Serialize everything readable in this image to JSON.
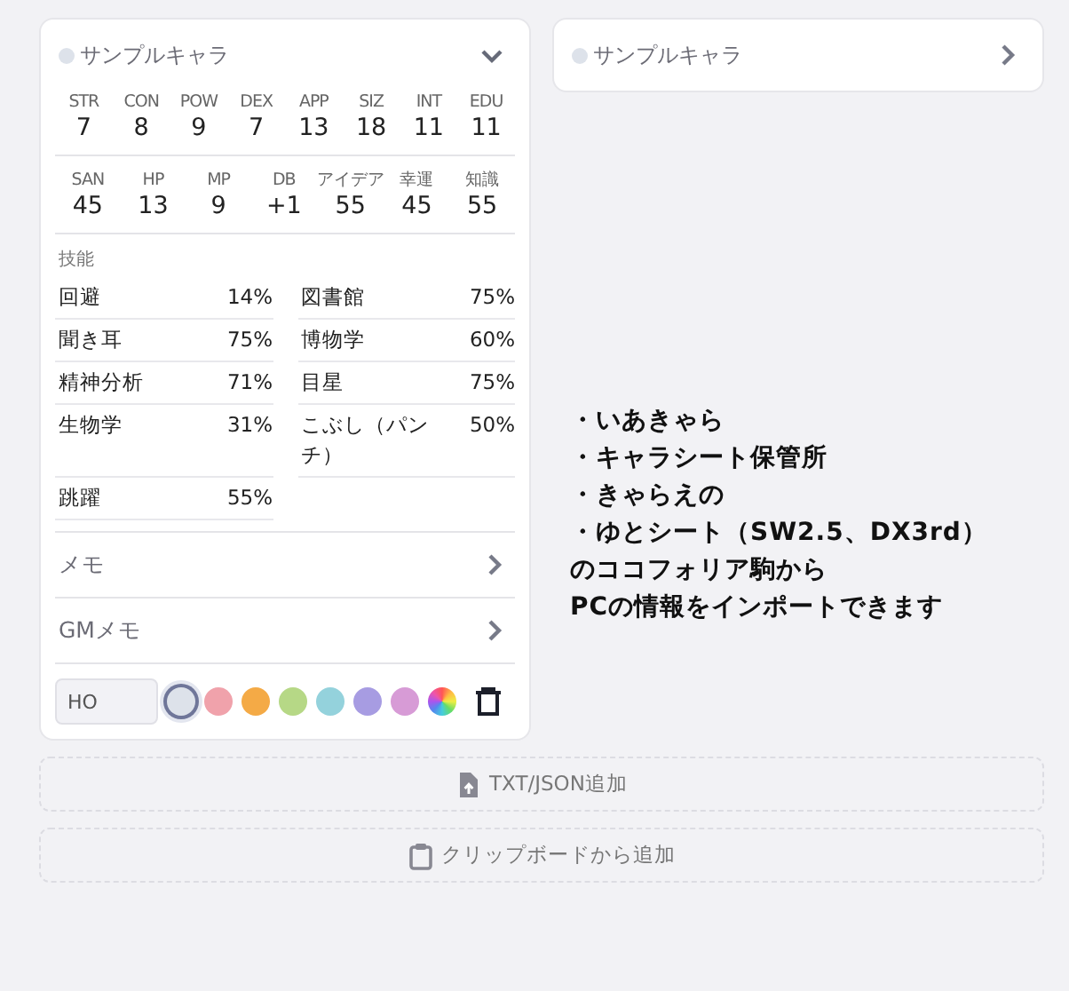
{
  "characters": [
    {
      "name": "サンプルキャラ",
      "expanded": true,
      "color": "#dde2ea",
      "stats": [
        [
          {
            "label": "STR",
            "value": "7"
          },
          {
            "label": "CON",
            "value": "8"
          },
          {
            "label": "POW",
            "value": "9"
          },
          {
            "label": "DEX",
            "value": "7"
          },
          {
            "label": "APP",
            "value": "13"
          },
          {
            "label": "SIZ",
            "value": "18"
          },
          {
            "label": "INT",
            "value": "11"
          },
          {
            "label": "EDU",
            "value": "11"
          }
        ],
        [
          {
            "label": "SAN",
            "value": "45"
          },
          {
            "label": "HP",
            "value": "13"
          },
          {
            "label": "MP",
            "value": "9"
          },
          {
            "label": "DB",
            "value": "+1"
          },
          {
            "label": "アイデア",
            "value": "55"
          },
          {
            "label": "幸運",
            "value": "45"
          },
          {
            "label": "知識",
            "value": "55"
          }
        ]
      ],
      "skills_label": "技能",
      "skills": [
        {
          "name": "回避",
          "value": "14%"
        },
        {
          "name": "図書館",
          "value": "75%"
        },
        {
          "name": "聞き耳",
          "value": "75%"
        },
        {
          "name": "博物学",
          "value": "60%"
        },
        {
          "name": "精神分析",
          "value": "71%"
        },
        {
          "name": "目星",
          "value": "75%"
        },
        {
          "name": "生物学",
          "value": "31%"
        },
        {
          "name": "こぶし（パンチ）",
          "value": "50%"
        },
        {
          "name": "跳躍",
          "value": "55%"
        }
      ],
      "sections": [
        {
          "label": "メモ",
          "expanded": false
        },
        {
          "label": "GMメモ",
          "expanded": false
        }
      ],
      "tag_field": {
        "placeholder": "HO"
      },
      "palette": [
        {
          "kind": "swatch",
          "color": "#dde2ea",
          "selected": true
        },
        {
          "kind": "swatch",
          "color": "#f0a2ab",
          "selected": false
        },
        {
          "kind": "swatch",
          "color": "#f4aa46",
          "selected": false
        },
        {
          "kind": "swatch",
          "color": "#b6d886",
          "selected": false
        },
        {
          "kind": "swatch",
          "color": "#94d2dc",
          "selected": false
        },
        {
          "kind": "swatch",
          "color": "#a79ce2",
          "selected": false
        },
        {
          "kind": "swatch",
          "color": "#d79bd6",
          "selected": false
        },
        {
          "kind": "rainbow",
          "selected": false
        }
      ]
    },
    {
      "name": "サンプルキャラ",
      "expanded": false,
      "color": "#dde2ea"
    }
  ],
  "notice": [
    "・いあきゃら",
    "・キャラシート保管所",
    "・きゃらえの",
    "・ゆとシート（SW2.5、DX3rd）",
    "のココフォリア駒から",
    "PCの情報をインポートできます"
  ],
  "buttons": [
    {
      "label": "TXT/JSON追加",
      "kind": "file"
    },
    {
      "label": "クリップボードから追加",
      "kind": "clipboard"
    }
  ]
}
